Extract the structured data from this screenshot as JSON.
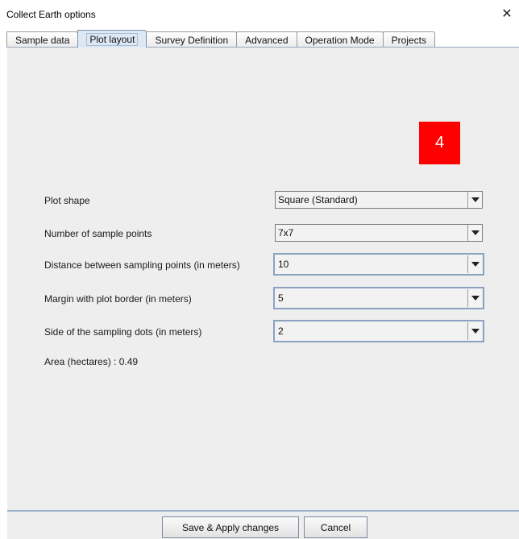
{
  "window": {
    "title": "Collect Earth options",
    "close_glyph": "✕"
  },
  "tabs": [
    {
      "label": "Sample data",
      "active": false
    },
    {
      "label": "Plot layout",
      "active": true
    },
    {
      "label": "Survey Definition",
      "active": false
    },
    {
      "label": "Advanced",
      "active": false
    },
    {
      "label": "Operation Mode",
      "active": false
    },
    {
      "label": "Projects",
      "active": false
    }
  ],
  "annotation_badge": {
    "text": "4",
    "color": "#ff0000"
  },
  "form": {
    "plot_shape": {
      "label": "Plot shape",
      "value": "Square (Standard)"
    },
    "sample_points": {
      "label": "Number of sample points",
      "value": "7x7"
    },
    "distance": {
      "label": "Distance between sampling points (in meters)",
      "value": "10"
    },
    "margin": {
      "label": "Margin with plot border (in meters)",
      "value": "5"
    },
    "dot_side": {
      "label": "Side of the sampling dots (in meters)",
      "value": "2"
    },
    "area": "Area (hectares)  :  0.49"
  },
  "footer": {
    "save_label": "Save & Apply changes",
    "cancel_label": "Cancel"
  },
  "icons": {
    "dropdown": "chevron-down-icon",
    "close": "close-icon"
  }
}
